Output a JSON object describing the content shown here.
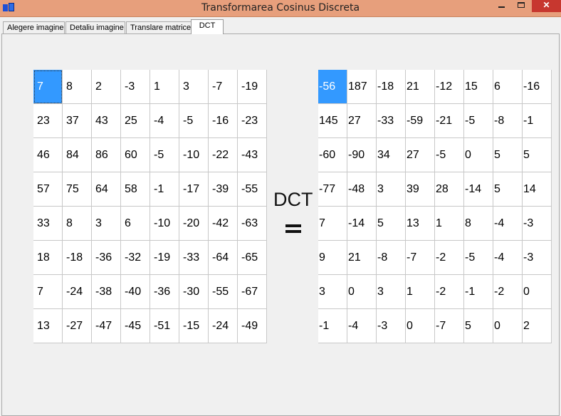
{
  "window": {
    "title": "Transformarea Cosinus Discreta",
    "close_label": "✕",
    "icon": "application-icon"
  },
  "tabs": [
    {
      "label": "Alegere imagine",
      "selected": false
    },
    {
      "label": "Detaliu imagine",
      "selected": false
    },
    {
      "label": "Translare matrice",
      "selected": false
    },
    {
      "label": "DCT",
      "selected": true
    }
  ],
  "dct_label": "DCT",
  "input_matrix": [
    [
      "7",
      "8",
      "2",
      "-3",
      "1",
      "3",
      "-7",
      "-19"
    ],
    [
      "23",
      "37",
      "43",
      "25",
      "-4",
      "-5",
      "-16",
      "-23"
    ],
    [
      "46",
      "84",
      "86",
      "60",
      "-5",
      "-10",
      "-22",
      "-43"
    ],
    [
      "57",
      "75",
      "64",
      "58",
      "-1",
      "-17",
      "-39",
      "-55"
    ],
    [
      "33",
      "8",
      "3",
      "6",
      "-10",
      "-20",
      "-42",
      "-63"
    ],
    [
      "18",
      "-18",
      "-36",
      "-32",
      "-19",
      "-33",
      "-64",
      "-65"
    ],
    [
      "7",
      "-24",
      "-38",
      "-40",
      "-36",
      "-30",
      "-55",
      "-67"
    ],
    [
      "13",
      "-27",
      "-47",
      "-45",
      "-51",
      "-15",
      "-24",
      "-49"
    ]
  ],
  "output_matrix": [
    [
      "-56",
      "187",
      "-18",
      "21",
      "-12",
      "15",
      "6",
      "-16"
    ],
    [
      "145",
      "27",
      "-33",
      "-59",
      "-21",
      "-5",
      "-8",
      "-1"
    ],
    [
      "-60",
      "-90",
      "34",
      "27",
      "-5",
      "0",
      "5",
      "5"
    ],
    [
      "-77",
      "-48",
      "3",
      "39",
      "28",
      "-14",
      "5",
      "14"
    ],
    [
      "7",
      "-14",
      "5",
      "13",
      "1",
      "8",
      "-4",
      "-3"
    ],
    [
      "9",
      "21",
      "-8",
      "-7",
      "-2",
      "-5",
      "-4",
      "-3"
    ],
    [
      "3",
      "0",
      "3",
      "1",
      "-2",
      "-1",
      "-2",
      "0"
    ],
    [
      "-1",
      "-4",
      "-3",
      "0",
      "-7",
      "5",
      "0",
      "2"
    ]
  ],
  "selected_cell": {
    "row": 0,
    "col": 0
  },
  "colors": {
    "titlebar": "#e79f7c",
    "selection": "#3399ff",
    "close_button": "#c7372f"
  }
}
